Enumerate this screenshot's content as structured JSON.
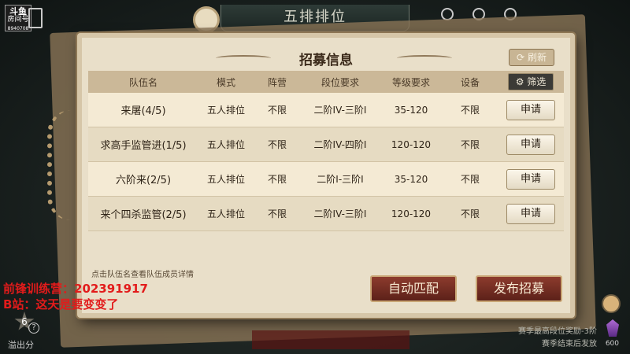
{
  "header": {
    "mode_title": "五排排位"
  },
  "logo": {
    "line1": "斗鱼",
    "line2": "房间号",
    "line3": "8940708"
  },
  "panel": {
    "title": "招募信息",
    "refresh_label": "刷新",
    "columns": [
      "队伍名",
      "模式",
      "阵营",
      "段位要求",
      "等级要求",
      "设备"
    ],
    "filter_label": "筛选",
    "rows": [
      {
        "team": "来屠(4/5)",
        "mode": "五人排位",
        "camp": "不限",
        "rank": "二阶IV-三阶I",
        "level": "35-120",
        "device": "不限",
        "action": "申请"
      },
      {
        "team": "求高手监管进(1/5)",
        "mode": "五人排位",
        "camp": "不限",
        "rank": "二阶IV-四阶I",
        "level": "120-120",
        "device": "不限",
        "action": "申请"
      },
      {
        "team": "六阶来(2/5)",
        "mode": "五人排位",
        "camp": "不限",
        "rank": "二阶I-三阶I",
        "level": "35-120",
        "device": "不限",
        "action": "申请"
      },
      {
        "team": "来个四杀监管(2/5)",
        "mode": "五人排位",
        "camp": "不限",
        "rank": "二阶IV-三阶I",
        "level": "120-120",
        "device": "不限",
        "action": "申请"
      }
    ],
    "hint": "点击队伍名查看队伍成员详情",
    "auto_match_label": "自动匹配",
    "publish_label": "发布招募"
  },
  "overlay": {
    "line1": "前锋训练营：202391917",
    "line2": "B站：这天是要变变了"
  },
  "bottom_left": {
    "score": "6",
    "help": "?",
    "overflow_label": "溢出分"
  },
  "bottom_right": {
    "season_line1": "赛季最高段位奖励-3阶",
    "season_line2": "赛季结束后发放",
    "gem_count": "600"
  },
  "colors": {
    "panel_bg": "#e9dfc9",
    "primary_button": "#7a2f24",
    "overlay_text": "#e21b1b"
  }
}
